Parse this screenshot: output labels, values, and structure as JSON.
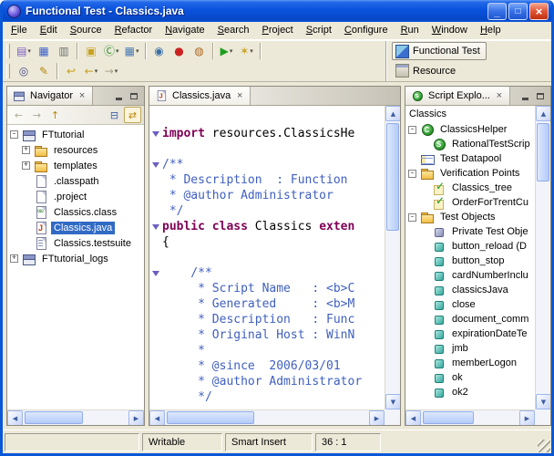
{
  "colors": {
    "titlebar_blue": "#0A52DE",
    "selection_blue": "#316AC5",
    "keyword_color": "#7F0055",
    "comment_color": "#3F5FBF",
    "record_red": "#CC2222",
    "run_green": "#1E9E1E",
    "toolbar_bg": "#ECE9D8"
  },
  "icons": {
    "close_tab": "×",
    "dropdown": "▾",
    "up_arrow": "▲",
    "down_arrow": "▼",
    "left_arrow": "◀",
    "right_arrow": "▶",
    "expander_plus": "+",
    "expander_minus": "-"
  },
  "window": {
    "title": "Functional Test - Classics.java",
    "controls": [
      {
        "name": "minimize-button",
        "glyph": "_",
        "kind": "min"
      },
      {
        "name": "maximize-button",
        "glyph": "□",
        "kind": "max"
      },
      {
        "name": "close-button",
        "glyph": "×",
        "kind": "close"
      }
    ]
  },
  "menubar": {
    "items": [
      "File",
      "Edit",
      "Source",
      "Refactor",
      "Navigate",
      "Search",
      "Project",
      "Script",
      "Configure",
      "Run",
      "Window",
      "Help"
    ]
  },
  "toolbar": {
    "row1": [
      {
        "name": "new-script-button",
        "glyph": "▤",
        "color": "#7A5CC6",
        "dropdown": true
      },
      {
        "name": "save-button",
        "glyph": "▦",
        "color": "#3A5FCD"
      },
      {
        "name": "print-button",
        "glyph": "▥",
        "color": "#6E6E6E",
        "sep_after": true
      },
      {
        "name": "new-test-folder-button",
        "glyph": "▣",
        "color": "#C8A020"
      },
      {
        "name": "new-class-button",
        "glyph": "Ⓒ",
        "color": "#2E8B2E",
        "dropdown": true
      },
      {
        "name": "new-datapool-button",
        "glyph": "▦",
        "color": "#4A7AB5",
        "dropdown": true,
        "sep_after": true
      },
      {
        "name": "connect-application-button",
        "glyph": "◉",
        "color": "#3A6EA5"
      },
      {
        "name": "record-button",
        "glyph": "●",
        "color": "#CC2222"
      },
      {
        "name": "insert-recording-button",
        "glyph": "◍",
        "color": "#B06820",
        "sep_after": true
      },
      {
        "name": "run-button",
        "glyph": "▶",
        "color": "#1E9E1E",
        "dropdown": true
      },
      {
        "name": "wizard-button",
        "glyph": "✶",
        "color": "#C8A020",
        "dropdown": true,
        "sep_after": true
      }
    ],
    "row2": [
      {
        "name": "search-button",
        "glyph": "◎",
        "color": "#4A4A8A"
      },
      {
        "name": "mark-occurrences-button",
        "glyph": "✎",
        "color": "#B8860B",
        "sep_after": true
      },
      {
        "name": "last-edit-location-button",
        "glyph": "↩",
        "color": "#C8A020"
      },
      {
        "name": "back-button",
        "glyph": "←",
        "color": "#C8A020",
        "dropdown": true
      },
      {
        "name": "forward-button",
        "glyph": "→",
        "color": "#9A9A9A",
        "disabled": true,
        "dropdown": true
      }
    ],
    "perspectives": [
      {
        "name": "perspective-functional-test",
        "label": "Functional Test",
        "active": true
      },
      {
        "name": "perspective-resource",
        "label": "Resource",
        "active": false
      }
    ]
  },
  "navigator": {
    "title": "Navigator",
    "toolbar": [
      {
        "name": "back-icon",
        "glyph": "←",
        "disabled": true
      },
      {
        "name": "forward-icon",
        "glyph": "→",
        "disabled": true
      },
      {
        "name": "up-icon",
        "glyph": "↑"
      },
      {
        "name": "collapse-all-icon",
        "glyph": "⊟",
        "right": true,
        "blue": true
      },
      {
        "name": "link-editor-icon",
        "glyph": "⇄",
        "right": false,
        "pressed": true
      }
    ],
    "tree": [
      {
        "indent": 0,
        "expander": "minus",
        "icon": "project",
        "label": "FTtutorial"
      },
      {
        "indent": 1,
        "expander": "plus",
        "icon": "folder",
        "label": "resources"
      },
      {
        "indent": 1,
        "expander": "plus",
        "icon": "folder",
        "label": "templates"
      },
      {
        "indent": 1,
        "icon": "file",
        "label": ".classpath"
      },
      {
        "indent": 1,
        "icon": "file",
        "label": ".project"
      },
      {
        "indent": 1,
        "icon": "classfile",
        "label": "Classics.class"
      },
      {
        "indent": 1,
        "icon": "javafile",
        "label": "Classics.java",
        "selected": true
      },
      {
        "indent": 1,
        "icon": "testsuite",
        "label": "Classics.testsuite"
      },
      {
        "indent": 0,
        "expander": "plus",
        "icon": "project",
        "label": "FTtutorial_logs"
      }
    ]
  },
  "editor": {
    "tab": "Classics.java",
    "lines": [
      {
        "segs": []
      },
      {
        "fold": true,
        "segs": [
          {
            "c": "kw",
            "t": "import "
          },
          {
            "c": "pl",
            "t": "resources.ClassicsHe"
          }
        ]
      },
      {
        "segs": []
      },
      {
        "fold": true,
        "segs": [
          {
            "c": "cm",
            "t": "/**"
          }
        ]
      },
      {
        "segs": [
          {
            "c": "cm",
            "t": " * Description  : Function"
          }
        ]
      },
      {
        "segs": [
          {
            "c": "cm",
            "t": " * @author Administrator"
          }
        ]
      },
      {
        "segs": [
          {
            "c": "cm",
            "t": " */"
          }
        ]
      },
      {
        "fold": true,
        "segs": [
          {
            "c": "kw",
            "t": "public class "
          },
          {
            "c": "pl",
            "t": "Classics "
          },
          {
            "c": "kw",
            "t": "exten"
          }
        ]
      },
      {
        "segs": [
          {
            "c": "pl",
            "t": "{"
          }
        ]
      },
      {
        "segs": []
      },
      {
        "fold": true,
        "segs": [
          {
            "c": "cm",
            "t": "    /**"
          }
        ]
      },
      {
        "segs": [
          {
            "c": "cm",
            "t": "     * Script Name   : <b>C"
          }
        ]
      },
      {
        "segs": [
          {
            "c": "cm",
            "t": "     * Generated     : <b>M"
          }
        ]
      },
      {
        "segs": [
          {
            "c": "cm",
            "t": "     * Description   : Func"
          }
        ]
      },
      {
        "segs": [
          {
            "c": "cm",
            "t": "     * Original Host : WinN"
          }
        ]
      },
      {
        "segs": [
          {
            "c": "cm",
            "t": "     *"
          }
        ]
      },
      {
        "segs": [
          {
            "c": "cm",
            "t": "     * @since  2006/03/01"
          }
        ]
      },
      {
        "segs": [
          {
            "c": "cm",
            "t": "     * @author Administrator"
          }
        ]
      },
      {
        "segs": [
          {
            "c": "cm",
            "t": "     */"
          }
        ]
      }
    ]
  },
  "script_explorer": {
    "title": "Script Explo...",
    "root": "Classics",
    "tree": [
      {
        "indent": 0,
        "expander": "minus",
        "icon": "helper",
        "label": "ClassicsHelper"
      },
      {
        "indent": 1,
        "icon": "script",
        "label": "RationalTestScrip"
      },
      {
        "indent": 0,
        "icon": "datapool",
        "label": "Test Datapool"
      },
      {
        "indent": 0,
        "expander": "minus",
        "icon": "vpfolder",
        "label": "Verification Points"
      },
      {
        "indent": 1,
        "icon": "vp",
        "label": "Classics_tree"
      },
      {
        "indent": 1,
        "icon": "vp",
        "label": "OrderForTrentCu"
      },
      {
        "indent": 0,
        "expander": "minus",
        "icon": "tofolder",
        "label": "Test Objects"
      },
      {
        "indent": 1,
        "icon": "privateobj",
        "label": "Private Test Obje"
      },
      {
        "indent": 1,
        "icon": "testobj",
        "label": "button_reload (D"
      },
      {
        "indent": 1,
        "icon": "testobj",
        "label": "button_stop"
      },
      {
        "indent": 1,
        "icon": "testobj",
        "label": "cardNumberInclu"
      },
      {
        "indent": 1,
        "icon": "testobj",
        "label": "classicsJava"
      },
      {
        "indent": 1,
        "icon": "testobj",
        "label": "close"
      },
      {
        "indent": 1,
        "icon": "testobj",
        "label": "document_comm"
      },
      {
        "indent": 1,
        "icon": "testobj",
        "label": "expirationDateTe"
      },
      {
        "indent": 1,
        "icon": "testobj",
        "label": "jmb"
      },
      {
        "indent": 1,
        "icon": "testobj",
        "label": "memberLogon"
      },
      {
        "indent": 1,
        "icon": "testobj",
        "label": "ok"
      },
      {
        "indent": 1,
        "icon": "testobj",
        "label": "ok2"
      }
    ]
  },
  "statusbar": {
    "writable": "Writable",
    "insert_mode": "Smart Insert",
    "position": "36 : 1"
  }
}
